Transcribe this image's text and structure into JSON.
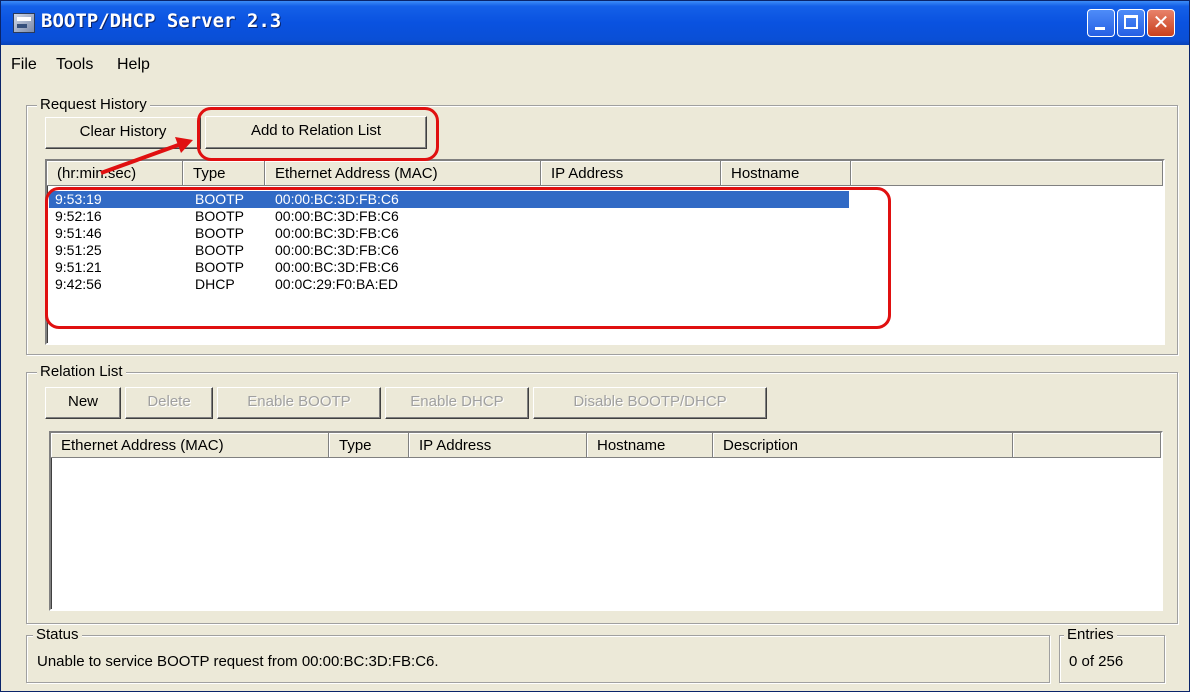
{
  "window": {
    "title": "BOOTP/DHCP Server 2.3"
  },
  "menu": {
    "file": "File",
    "tools": "Tools",
    "help": "Help"
  },
  "request_history": {
    "legend": "Request History",
    "clear_button": "Clear History",
    "add_button": "Add to Relation List",
    "columns": [
      "(hr:min:sec)",
      "Type",
      "Ethernet Address (MAC)",
      "IP Address",
      "Hostname"
    ],
    "rows": [
      {
        "time": "9:53:19",
        "type": "BOOTP",
        "mac": "00:00:BC:3D:FB:C6"
      },
      {
        "time": "9:52:16",
        "type": "BOOTP",
        "mac": "00:00:BC:3D:FB:C6"
      },
      {
        "time": "9:51:46",
        "type": "BOOTP",
        "mac": "00:00:BC:3D:FB:C6"
      },
      {
        "time": "9:51:25",
        "type": "BOOTP",
        "mac": "00:00:BC:3D:FB:C6"
      },
      {
        "time": "9:51:21",
        "type": "BOOTP",
        "mac": "00:00:BC:3D:FB:C6"
      },
      {
        "time": "9:42:56",
        "type": "DHCP",
        "mac": "00:0C:29:F0:BA:ED"
      }
    ]
  },
  "relation_list": {
    "legend": "Relation List",
    "new_button": "New",
    "delete_button": "Delete",
    "enable_bootp_button": "Enable BOOTP",
    "enable_dhcp_button": "Enable DHCP",
    "disable_button": "Disable BOOTP/DHCP",
    "columns": [
      "Ethernet Address (MAC)",
      "Type",
      "IP Address",
      "Hostname",
      "Description"
    ]
  },
  "status": {
    "legend": "Status",
    "message": "Unable to service BOOTP request from 00:00:BC:3D:FB:C6."
  },
  "entries": {
    "legend": "Entries",
    "value": "0 of 256"
  },
  "colors": {
    "annotation": "#e01010",
    "selection": "#316ac5",
    "titlebar": "#0a52e0"
  }
}
